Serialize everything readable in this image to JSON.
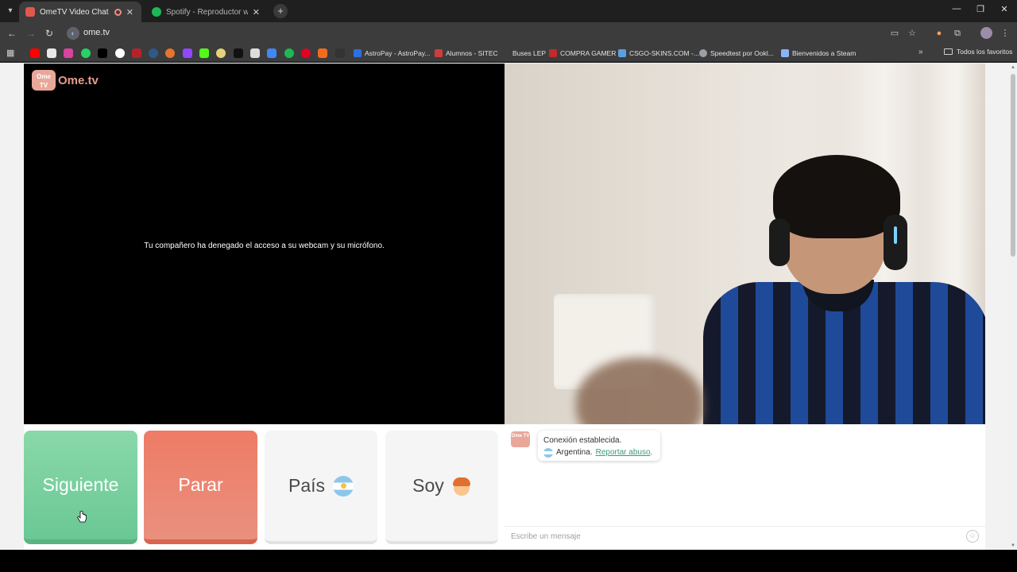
{
  "browser": {
    "tabs": [
      {
        "title": "OmeTV Video Chat — Ome",
        "active": true,
        "favicon_color": "#e0584f"
      },
      {
        "title": "Spotify - Reproductor web: mú",
        "active": false,
        "favicon_color": "#1db954"
      }
    ],
    "url": "ome.tv",
    "bookmarks": [
      {
        "label": "AstroPay - AstroPay...",
        "color": "#2f6fe0"
      },
      {
        "label": "Alumnos - SITEC",
        "color": "#d33b3b"
      },
      {
        "label": "Buses LEP",
        "color": "#3c3c3c"
      },
      {
        "label": "COMPRA GAMER",
        "color": "#c42a2a"
      },
      {
        "label": "CSGO-SKINS.COM -...",
        "color": "#5aa0e0"
      },
      {
        "label": "Speedtest por Ookl...",
        "color": "#9aa0a6"
      },
      {
        "label": "Bienvenidos a Steam",
        "color": "#8ab4f8"
      }
    ],
    "all_bookmarks_label": "Todos los favoritos"
  },
  "app": {
    "logo_text": "Ome.tv",
    "logo_badge": "Ome TV",
    "partner_message": "Tu compañero ha denegado el acceso a su webcam y su micrófono.",
    "buttons": {
      "next": "Siguiente",
      "stop": "Parar",
      "country": "País",
      "soy": "Soy"
    },
    "chat": {
      "status": "Conexión establecida.",
      "country": "Argentina.",
      "report": "Reportar abuso",
      "report_suffix": ".",
      "input_placeholder": "Escribe un mensaje"
    }
  },
  "colors": {
    "next": "#6ac895",
    "stop": "#ee7b66",
    "brand": "#e79c8d"
  }
}
